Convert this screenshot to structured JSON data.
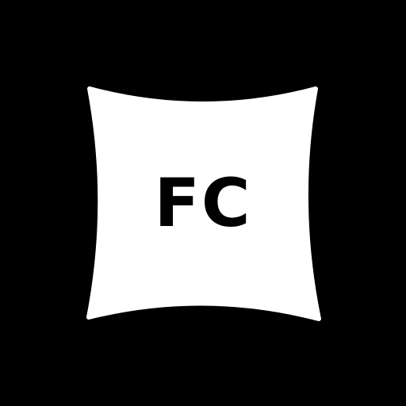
{
  "logo": {
    "text": "FC",
    "background_color": "#000000",
    "shape_color": "#ffffff",
    "text_color": "#000000",
    "shape_icon": "pillow-square-icon"
  }
}
